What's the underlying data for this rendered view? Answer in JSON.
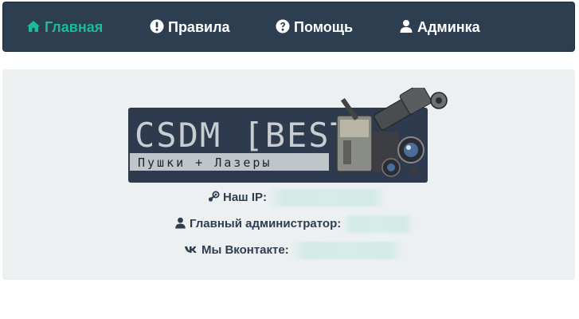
{
  "nav": {
    "items": [
      {
        "label": "Главная",
        "icon": "home-icon",
        "active": true
      },
      {
        "label": "Правила",
        "icon": "exclamation-circle-icon",
        "active": false
      },
      {
        "label": "Помощь",
        "icon": "question-circle-icon",
        "active": false
      },
      {
        "label": "Админка",
        "icon": "user-icon",
        "active": false
      }
    ]
  },
  "colors": {
    "navbar_bg": "#2c3e50",
    "accent": "#1abc9c",
    "panel_bg": "#ecf0f1",
    "text": "#2c3e50"
  },
  "logo": {
    "title": "CSDM [BEST]",
    "subtitle": "Пушки + Лазеры",
    "icon": "camera-gun-image"
  },
  "server_info": {
    "ip_label": "Наш IP:",
    "ip_icon": "steam-icon",
    "admin_label": "Главный администратор:",
    "admin_icon": "user-icon",
    "vk_label": "Мы Вконтакте:",
    "vk_icon": "vk-icon"
  }
}
